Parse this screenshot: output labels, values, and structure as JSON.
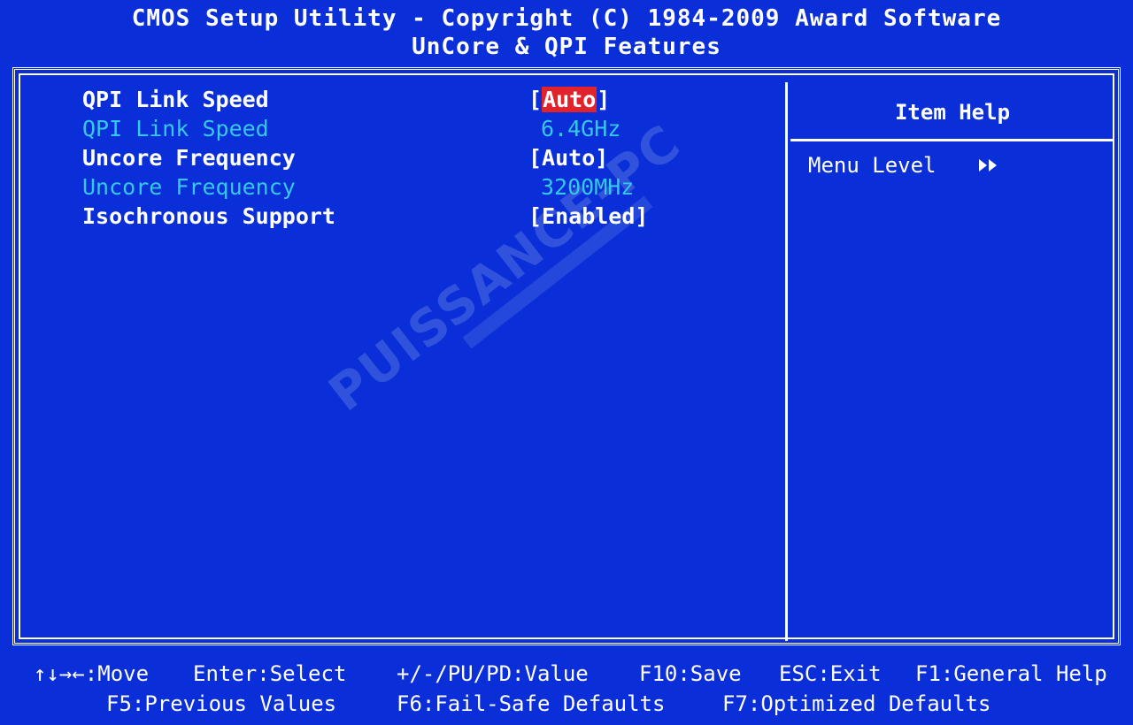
{
  "header": {
    "title": "CMOS Setup Utility - Copyright (C) 1984-2009 Award Software",
    "subtitle": "UnCore & QPI Features"
  },
  "settings": [
    {
      "label": "QPI Link Speed",
      "value": "[Auto]",
      "value_prefix": "[",
      "value_core": "Auto",
      "value_suffix": "]",
      "state": "selected"
    },
    {
      "label": "QPI Link Speed",
      "value": "6.4GHz",
      "state": "readonly"
    },
    {
      "label": "Uncore Frequency",
      "value": "[Auto]",
      "state": "active"
    },
    {
      "label": "Uncore Frequency",
      "value": "3200MHz",
      "state": "readonly"
    },
    {
      "label": "Isochronous Support",
      "value": "[Enabled]",
      "state": "active"
    }
  ],
  "help": {
    "title": "Item Help",
    "menu_level_label": "Menu Level",
    "menu_level_icon": "double-right-triangle"
  },
  "watermark": "PUISSANCE-PC",
  "footer": {
    "move": "↑↓→←:Move",
    "select": "Enter:Select",
    "value": "+/-/PU/PD:Value",
    "save": "F10:Save",
    "exit": "ESC:Exit",
    "general_help": "F1:General Help",
    "previous_values": "F5:Previous Values",
    "fail_safe": "F6:Fail-Safe Defaults",
    "optimized": "F7:Optimized Defaults"
  },
  "colors": {
    "background": "#0a2ed8",
    "text": "#ffffff",
    "readonly_text": "#36c8e8",
    "highlight": "#e2232b"
  }
}
